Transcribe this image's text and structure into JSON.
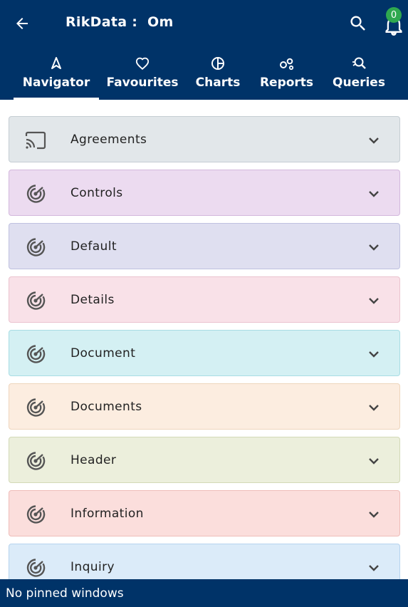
{
  "header": {
    "title": "RikData :  Om",
    "back_icon": "arrow-left-icon",
    "search_icon": "search-icon",
    "bell_icon": "bell-icon",
    "notification_count": "0",
    "bg_color": "#003368"
  },
  "tabs": [
    {
      "label": "Navigator",
      "icon": "navigation-icon",
      "active": true
    },
    {
      "label": "Favourites",
      "icon": "heart-icon",
      "active": false
    },
    {
      "label": "Charts",
      "icon": "pie-chart-icon",
      "active": false
    },
    {
      "label": "Reports",
      "icon": "reports-icon",
      "active": false
    },
    {
      "label": "Queries",
      "icon": "query-icon",
      "active": false
    }
  ],
  "sections": [
    {
      "label": "Agreements",
      "icon": "cast-icon",
      "bg": "#e2e7ea",
      "border": "#c5cdd3"
    },
    {
      "label": "Controls",
      "icon": "radar-icon",
      "bg": "#ecdbf0",
      "border": "#d3b8dd"
    },
    {
      "label": "Default",
      "icon": "radar-icon",
      "bg": "#dfdff0",
      "border": "#bfc1e0"
    },
    {
      "label": "Details",
      "icon": "radar-icon",
      "bg": "#f9e1e8",
      "border": "#ebc3cf"
    },
    {
      "label": "Document",
      "icon": "radar-icon",
      "bg": "#d4f0f3",
      "border": "#a8dde4"
    },
    {
      "label": "Documents",
      "icon": "radar-icon",
      "bg": "#fcede0",
      "border": "#eed6bd"
    },
    {
      "label": "Header",
      "icon": "radar-icon",
      "bg": "#ecefdc",
      "border": "#d3d9b7"
    },
    {
      "label": "Information",
      "icon": "radar-icon",
      "bg": "#fbdedc",
      "border": "#efbdb9"
    },
    {
      "label": "Inquiry",
      "icon": "radar-icon",
      "bg": "#dbebf9",
      "border": "#b6d3ee"
    }
  ],
  "footer": {
    "text": "No pinned windows"
  }
}
